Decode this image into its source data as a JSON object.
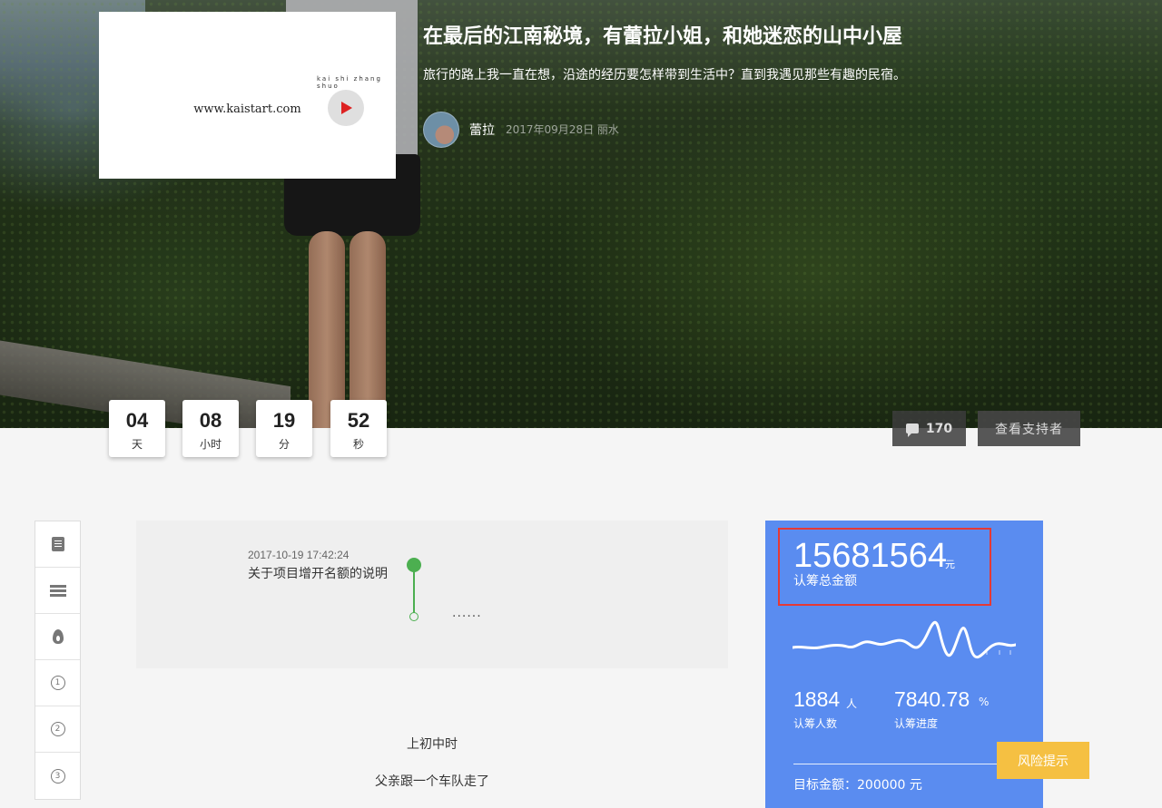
{
  "hero": {
    "video": {
      "url_text": "www.kaistart.com",
      "tiny_text": "kai  shi  zhang  shuo"
    },
    "title": "在最后的江南秘境，有蕾拉小姐，和她迷恋的山中小屋",
    "subtitle": "旅行的路上我一直在想，沿途的经历要怎样带到生活中？直到我遇见那些有趣的民宿。",
    "author": {
      "name": "蕾拉",
      "meta": "2017年09月28日 丽水"
    }
  },
  "countdown": [
    {
      "value": "04",
      "unit": "天"
    },
    {
      "value": "08",
      "unit": "小时"
    },
    {
      "value": "19",
      "unit": "分"
    },
    {
      "value": "52",
      "unit": "秒"
    }
  ],
  "actions": {
    "comment_count": "170",
    "supporters_label": "查看支持者"
  },
  "sidenav": {
    "num_items": [
      "1",
      "2",
      "3"
    ]
  },
  "timeline": {
    "timestamp": "2017-10-19 17:42:24",
    "event": "关于项目增开名额的说明",
    "more": "......"
  },
  "story": [
    "上初中时",
    "父亲跟一个车队走了"
  ],
  "stats": {
    "total": "15681564",
    "total_unit": "元",
    "total_label": "认筹总金额",
    "people": "1884",
    "people_unit": "人",
    "people_label": "认筹人数",
    "progress": "7840.78",
    "progress_unit": "%",
    "progress_label": "认筹进度",
    "goal": "目标金额：200000 元"
  },
  "risk_button": "风险提示",
  "colors": {
    "stats_bg": "#5a8cf0",
    "risk_bg": "#f5c042",
    "highlight_box": "#e53935",
    "timeline_green": "#4caf50"
  }
}
